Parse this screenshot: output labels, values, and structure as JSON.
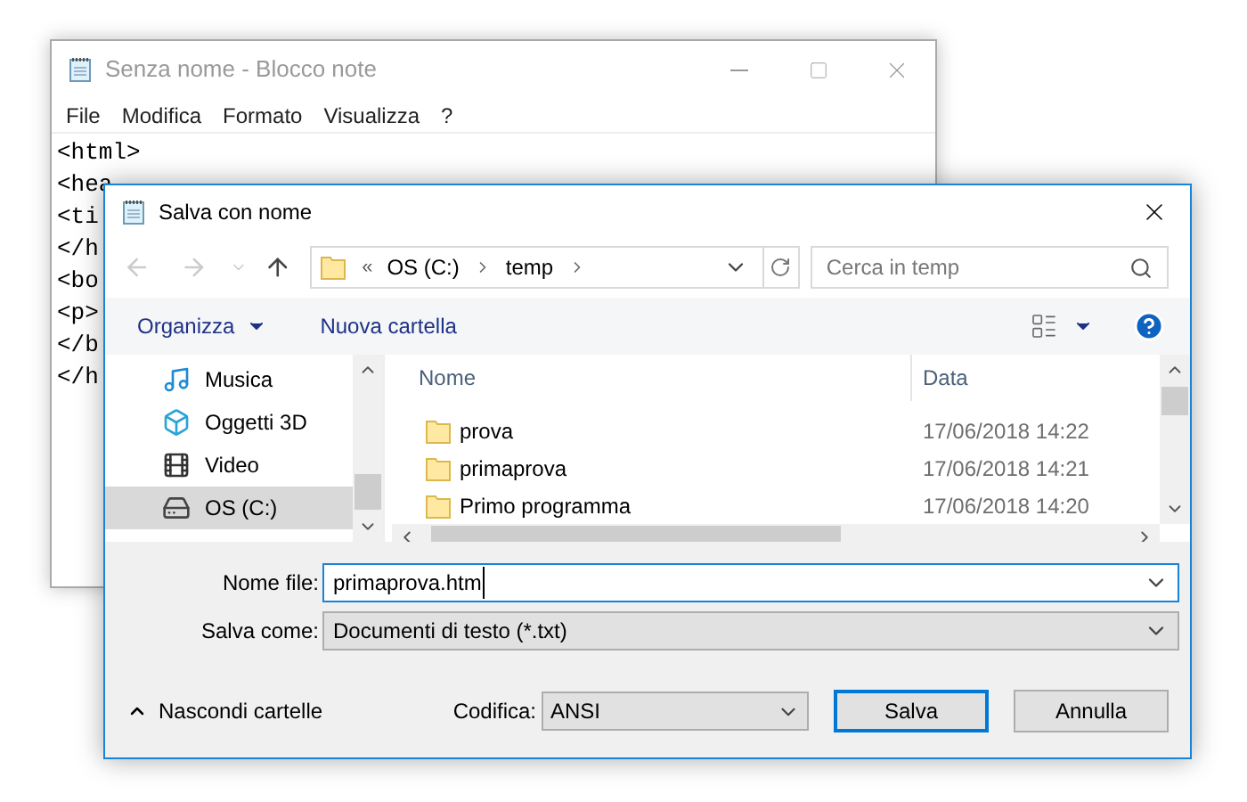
{
  "notepad": {
    "title": "Senza nome - Blocco note",
    "menu": [
      "File",
      "Modifica",
      "Formato",
      "Visualizza",
      "?"
    ],
    "lines": [
      "<html>",
      "<hea",
      "<ti",
      "</h",
      "<bo",
      "<p>",
      "</b",
      "</h"
    ]
  },
  "dialog": {
    "title": "Salva con nome",
    "address": {
      "overflow": "«",
      "crumbs": [
        "OS (C:)",
        "temp"
      ]
    },
    "search": {
      "placeholder": "Cerca in temp"
    },
    "toolbar": {
      "organize": "Organizza",
      "new_folder": "Nuova cartella"
    },
    "sidebar": {
      "items": [
        {
          "label": "Musica",
          "kind": "music",
          "selected": false
        },
        {
          "label": "Oggetti 3D",
          "kind": "objects",
          "selected": false
        },
        {
          "label": "Video",
          "kind": "video",
          "selected": false
        },
        {
          "label": "OS (C:)",
          "kind": "drive",
          "selected": true
        }
      ]
    },
    "files": {
      "columns": [
        "Nome",
        "Data"
      ],
      "rows": [
        {
          "name": "prova",
          "date": "17/06/2018 14:22"
        },
        {
          "name": "primaprova",
          "date": "17/06/2018 14:21"
        },
        {
          "name": "Primo programma",
          "date": "17/06/2018 14:20"
        }
      ]
    },
    "file_name": {
      "label": "Nome file:",
      "value": "primaprova.htm"
    },
    "save_as": {
      "label": "Salva come:",
      "value": "Documenti di testo (*.txt)"
    },
    "hide_folders": "Nascondi cartelle",
    "encoding": {
      "label": "Codifica:",
      "value": "ANSI"
    },
    "buttons": [
      {
        "label": "Salva",
        "default": true
      },
      {
        "label": "Annulla",
        "default": false
      }
    ]
  }
}
